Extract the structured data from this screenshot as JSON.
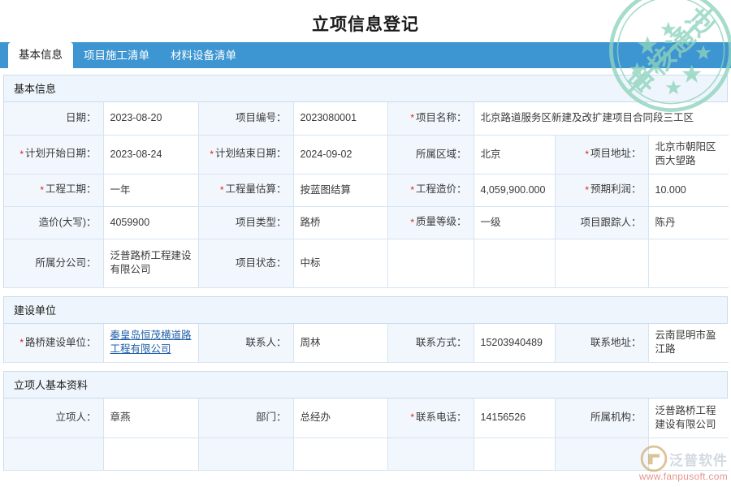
{
  "header": {
    "title": "立项信息登记"
  },
  "tabs": [
    {
      "label": "基本信息",
      "active": true
    },
    {
      "label": "项目施工清单",
      "active": false
    },
    {
      "label": "材料设备清单",
      "active": false
    }
  ],
  "sections": [
    {
      "title": "基本信息",
      "rows": [
        [
          {
            "label": "日期：",
            "value": "2023-08-20",
            "required": false
          },
          {
            "label": "项目编号：",
            "value": "2023080001",
            "required": false
          },
          {
            "label": "项目名称：",
            "value": "北京路道服务区新建及改扩建项目合同段三工区",
            "required": true,
            "span": 4
          }
        ],
        [
          {
            "label": "计划开始日期：",
            "value": "2023-08-24",
            "required": true
          },
          {
            "label": "计划结束日期：",
            "value": "2024-09-02",
            "required": true
          },
          {
            "label": "所属区域：",
            "value": "北京",
            "required": false
          },
          {
            "label": "项目地址：",
            "value": "北京市朝阳区西大望路",
            "required": true
          }
        ],
        [
          {
            "label": "工程工期：",
            "value": "一年",
            "required": true
          },
          {
            "label": "工程量估算：",
            "value": "按蓝图结算",
            "required": true
          },
          {
            "label": "工程造价：",
            "value": "4,059,900.000",
            "required": true
          },
          {
            "label": "预期利润：",
            "value": "10.000",
            "required": true
          }
        ],
        [
          {
            "label": "造价(大写)：",
            "value": "4059900",
            "required": false
          },
          {
            "label": "项目类型：",
            "value": "路桥",
            "required": false
          },
          {
            "label": "质量等级：",
            "value": "一级",
            "required": true
          },
          {
            "label": "项目跟踪人：",
            "value": "陈丹",
            "required": false
          }
        ],
        [
          {
            "label": "所属分公司：",
            "value": "泛普路桥工程建设有限公司",
            "required": false
          },
          {
            "label": "项目状态：",
            "value": "中标",
            "required": false
          },
          {
            "label": "",
            "value": "",
            "required": false,
            "blank": true
          },
          {
            "label": "",
            "value": "",
            "required": false,
            "blank": true
          }
        ]
      ]
    },
    {
      "title": "建设单位",
      "rows": [
        [
          {
            "label": "路桥建设单位：",
            "value": "秦皇岛恒茂横道路工程有限公司",
            "required": true,
            "link": true
          },
          {
            "label": "联系人：",
            "value": "周林",
            "required": false
          },
          {
            "label": "联系方式：",
            "value": "15203940489",
            "required": false
          },
          {
            "label": "联系地址：",
            "value": "云南昆明市盈江路",
            "required": false
          }
        ]
      ]
    },
    {
      "title": "立项人基本资料",
      "rows": [
        [
          {
            "label": "立项人：",
            "value": "章燕",
            "required": false
          },
          {
            "label": "部门：",
            "value": "总经办",
            "required": false
          },
          {
            "label": "联系电话：",
            "value": "14156526",
            "required": true
          },
          {
            "label": "所属机构：",
            "value": "泛普路桥工程建设有限公司",
            "required": false
          }
        ]
      ]
    }
  ],
  "stamp": {
    "text": "审核通过",
    "color": "#8ed3bd"
  },
  "watermark": {
    "brand": "泛普软件",
    "url": "www.fanpusoft.com",
    "url_color": "#d9544a"
  },
  "colors": {
    "tabbar": "#3d95d1",
    "section_head": "#eef5fc",
    "label_cell": "#f2f7fd",
    "border": "#d6e4f2",
    "required": "#e02020",
    "link": "#1e5fa8"
  }
}
